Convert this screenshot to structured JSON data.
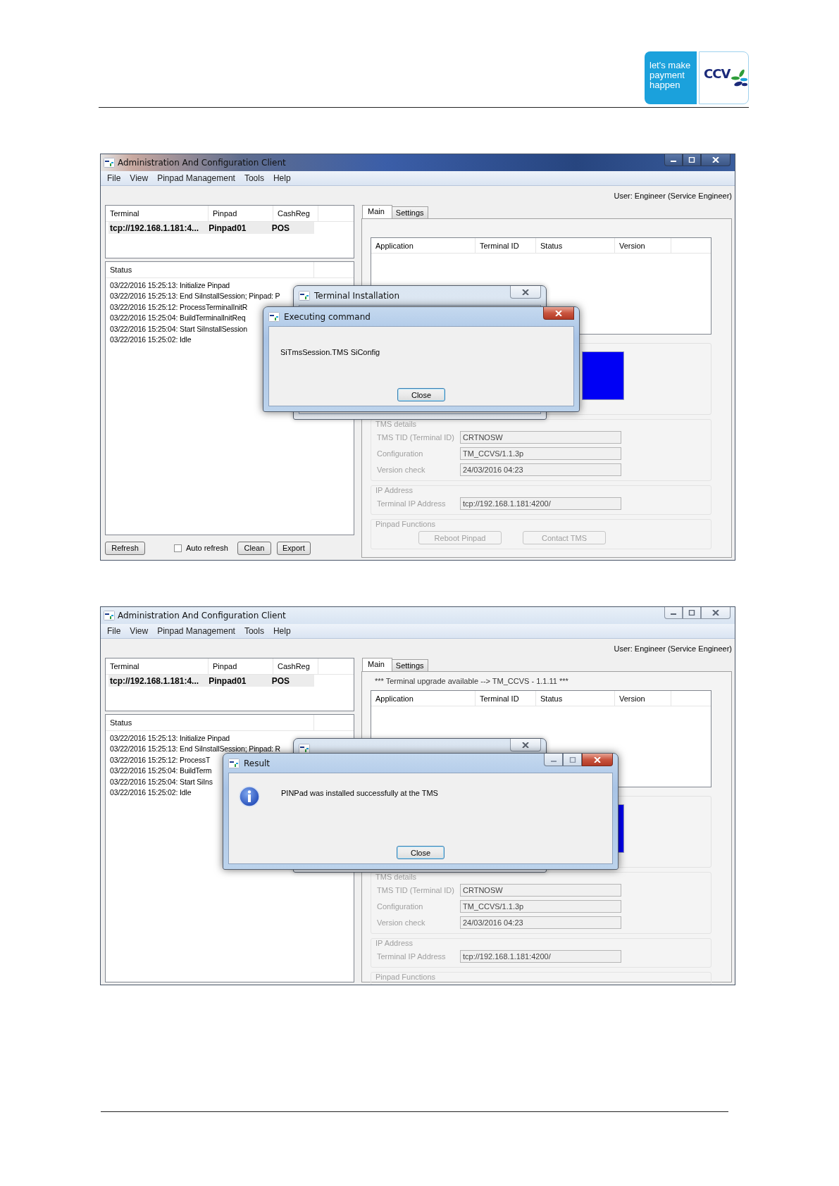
{
  "header": {
    "tagline": "let's make payment happen",
    "brand": "CCV"
  },
  "screenshots": [
    {
      "window": {
        "title": "Administration And Configuration Client",
        "active": true
      },
      "menu": [
        "File",
        "View",
        "Pinpad Management",
        "Tools",
        "Help"
      ],
      "user": "User: Engineer  (Service Engineer)",
      "terminals": {
        "columns": [
          "Terminal",
          "Pinpad",
          "CashReg"
        ],
        "rows": [
          {
            "cells": [
              "tcp://192.168.1.181:4...",
              "Pinpad01",
              "POS"
            ],
            "selected": true
          }
        ]
      },
      "status": {
        "column": "Status",
        "lines": [
          "03/22/2016 15:25:13: Initialize Pinpad",
          "03/22/2016 15:25:13: End SiInstallSession; Pinpad: P",
          "03/22/2016 15:25:12: ProcessTerminalInitR",
          "03/22/2016 15:25:04: BuildTerminalInitReq",
          "03/22/2016 15:25:04: Start SiInstallSession",
          "03/22/2016 15:25:02: Idle"
        ]
      },
      "controls": [
        {
          "kind": "button",
          "label": "Refresh"
        },
        {
          "kind": "checkbox",
          "label": "Auto refresh",
          "checked": false
        },
        {
          "kind": "button",
          "label": "Clean"
        },
        {
          "kind": "button",
          "label": "Export"
        }
      ],
      "tabs": [
        {
          "label": "Main",
          "selected": true
        },
        {
          "label": "Settings",
          "selected": false
        }
      ],
      "applications": {
        "columns": [
          "Application",
          "Terminal ID",
          "Status",
          "Version"
        ]
      },
      "groups": [
        {
          "legend": "TMS details",
          "fields": [
            {
              "label": "TMS TID (Terminal ID)",
              "value": "CRTNOSW"
            },
            {
              "label": "Configuration",
              "value": "TM_CCVS/1.1.3p"
            },
            {
              "label": "Version check",
              "value": "24/03/2016 04:23"
            }
          ]
        },
        {
          "legend": "IP Address",
          "fields": [
            {
              "label": "Terminal IP Address",
              "value": "tcp://192.168.1.181:4200/"
            }
          ]
        },
        {
          "legend": "Pinpad Functions",
          "buttons": [
            {
              "label": "Reboot Pinpad",
              "disabled": true
            },
            {
              "label": "Contact TMS",
              "disabled": true
            }
          ]
        }
      ],
      "dialogs": [
        {
          "kind": "background",
          "title": "Terminal Installation"
        },
        {
          "kind": "message",
          "title": "Executing command",
          "message": "SiTmsSession.TMS SiConfig",
          "button": "Close"
        }
      ]
    },
    {
      "window": {
        "title": "Administration And Configuration Client",
        "active": false
      },
      "menu": [
        "File",
        "View",
        "Pinpad Management",
        "Tools",
        "Help"
      ],
      "user": "User: Engineer  (Service Engineer)",
      "terminals": {
        "columns": [
          "Terminal",
          "Pinpad",
          "CashReg"
        ],
        "rows": [
          {
            "cells": [
              "tcp://192.168.1.181:4...",
              "Pinpad01",
              "POS"
            ],
            "selected": true
          }
        ]
      },
      "status": {
        "column": "Status",
        "lines": [
          "03/22/2016 15:25:13: Initialize Pinpad",
          "03/22/2016 15:25:13: End SiInstallSession; Pinpad: R",
          "03/22/2016 15:25:12: ProcessT",
          "03/22/2016 15:25:04: BuildTerm",
          "03/22/2016 15:25:04: Start SiIns",
          "03/22/2016 15:25:02: Idle"
        ]
      },
      "tabs": [
        {
          "label": "Main",
          "selected": true
        },
        {
          "label": "Settings",
          "selected": false
        }
      ],
      "notice": "*** Terminal upgrade available --> TM_CCVS - 1.1.11 ***",
      "applications": {
        "columns": [
          "Application",
          "Terminal ID",
          "Status",
          "Version"
        ]
      },
      "groups": [
        {
          "legend": "TMS details",
          "fields": [
            {
              "label": "TMS TID (Terminal ID)",
              "value": "CRTNOSW"
            },
            {
              "label": "Configuration",
              "value": "TM_CCVS/1.1.3p"
            },
            {
              "label": "Version check",
              "value": "24/03/2016 04:23"
            }
          ]
        },
        {
          "legend": "IP Address",
          "fields": [
            {
              "label": "Terminal IP Address",
              "value": "tcp://192.168.1.181:4200/"
            }
          ]
        },
        {
          "legend": "Pinpad Functions"
        }
      ],
      "dialogs": [
        {
          "kind": "background"
        },
        {
          "kind": "info",
          "title": "Result",
          "message": "PINPad was installed successfully at the TMS",
          "button": "Close"
        }
      ]
    }
  ]
}
